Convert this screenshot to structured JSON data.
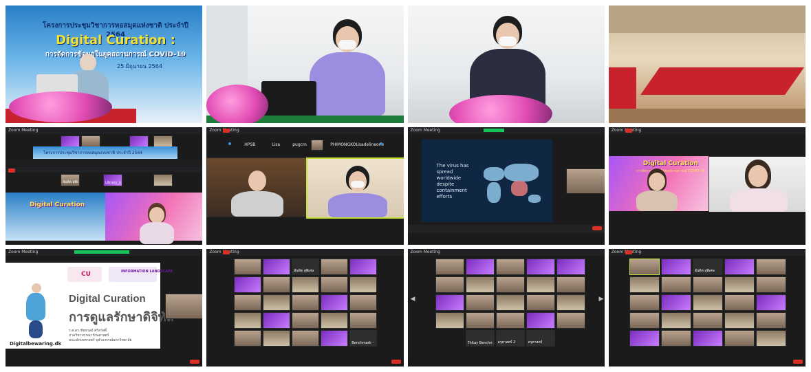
{
  "banner": {
    "line1": "โครงการประชุมวิชาการหอสมุดแห่งชาติ ประจำปี 2564",
    "title": "Digital Curation :",
    "subtitle": "การจัดการข้อมูลในยุคสถานการณ์ COVID-19",
    "date": "25 มิถุนายน 2564"
  },
  "zoom": {
    "window_title": "Zoom Meeting",
    "top_banner_line": "โครงการประชุมวิชาการหอสมุดแห่งชาติ ประจำปี 2564",
    "tile_b_names": [
      "สันดิต สุพิเศษ",
      "ครุศาสตร์",
      "Library_statue"
    ],
    "tile_f_names": [
      "HPSB",
      "Lisa",
      "pugcm",
      "PHIMONGKOL",
      "isadelineone"
    ]
  },
  "pink_slide": {
    "title": "Digital Curation",
    "subtitle": "การจัดการข้อมูลในยุคสถานการณ์ COVID-19"
  },
  "map_slide": {
    "heading": "The virus has spread worldwide despite containment efforts"
  },
  "dc_slide": {
    "line1": "Digital Curation",
    "line2": "การดูแลรักษาดิจิทัล",
    "presenter": "ร.ศ.ดร.ชัชชวลย์ ศรีสวัสดิ์",
    "dept": "ภาควิชาบรรณารักษศาสตร์",
    "faculty": "คณะอักษรศาสตร์ จุฬาลงกรณ์มหาวิทยาลัย",
    "url": "Digitalbewaring.dk",
    "logo_cu": "CU",
    "logo_il": "INFORMATION LANDSCAPE"
  },
  "gallery_names": {
    "g1": "สันดิต สุพิเศษ",
    "g2": "Benchmark - Punto",
    "g3": "Thitay Benchmark",
    "g4": "ครุศาสตร์ 2",
    "g5": "ครุศาสตร์"
  },
  "colors": {
    "zoom_dark": "#1b1b1b",
    "recording_red": "#d93025",
    "banner_blue": "#2a7fc7",
    "title_yellow": "#f4e233"
  }
}
